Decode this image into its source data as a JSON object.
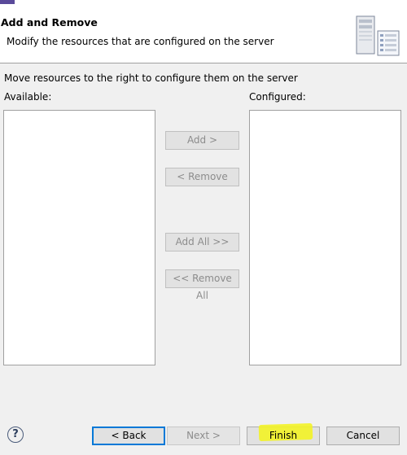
{
  "header": {
    "title": "Add and Remove",
    "description": "Modify the resources that are configured on the server",
    "server_icon": "server-icon"
  },
  "instructions": "Move resources to the right to configure them on the server",
  "available": {
    "label": "Available:",
    "items": []
  },
  "configured": {
    "label": "Configured:",
    "items": []
  },
  "transfer_buttons": {
    "add": "Add >",
    "remove": "< Remove",
    "add_all": "Add All >>",
    "remove_all": "<< Remove All"
  },
  "footer": {
    "help": "?",
    "back": "< Back",
    "next": "Next >",
    "finish": "Finish",
    "cancel": "Cancel"
  },
  "colors": {
    "highlight": "#f3f326",
    "focus_border": "#0078d7"
  }
}
